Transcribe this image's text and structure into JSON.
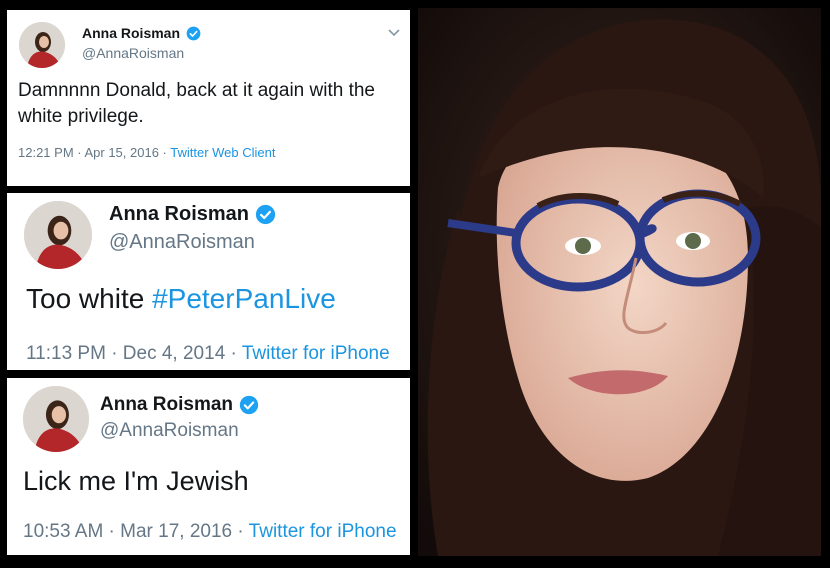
{
  "tweets": [
    {
      "name": "Anna Roisman",
      "handle": "@AnnaRoisman",
      "text": "Damnnnn Donald, back at it again with the white privilege.",
      "time": "12:21 PM · Apr 15, 2016 · ",
      "source": "Twitter Web Client"
    },
    {
      "name": "Anna Roisman",
      "handle": "@AnnaRoisman",
      "text": "Too white ",
      "hashtag": "#PeterPanLive",
      "time": "11:13 PM · Dec 4, 2014 · ",
      "source": "Twitter for iPhone"
    },
    {
      "name": "Anna Roisman",
      "handle": "@AnnaRoisman",
      "text": "Lick me I'm Jewish",
      "time": "10:53 AM · Mar 17, 2016 · ",
      "source": "Twitter for iPhone"
    }
  ],
  "icons": {
    "verified": "verified-badge-icon",
    "menu": "chevron-down-icon"
  },
  "colors": {
    "link": "#1b95e0",
    "verified": "#1da1f2",
    "meta": "#657786",
    "text": "#14171a"
  }
}
